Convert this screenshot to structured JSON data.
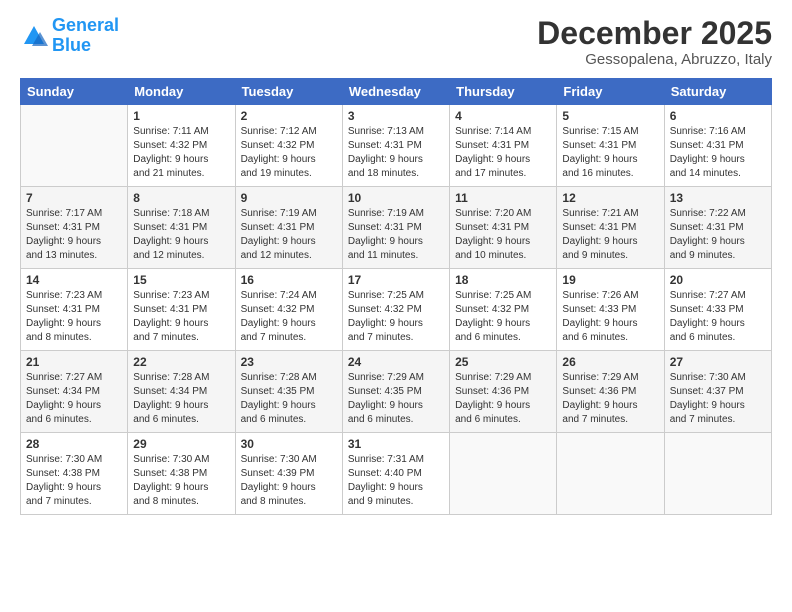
{
  "header": {
    "logo_general": "General",
    "logo_blue": "Blue",
    "month": "December 2025",
    "location": "Gessopalena, Abruzzo, Italy"
  },
  "days_header": [
    "Sunday",
    "Monday",
    "Tuesday",
    "Wednesday",
    "Thursday",
    "Friday",
    "Saturday"
  ],
  "weeks": [
    [
      {
        "day": "",
        "text": ""
      },
      {
        "day": "1",
        "text": "Sunrise: 7:11 AM\nSunset: 4:32 PM\nDaylight: 9 hours\nand 21 minutes."
      },
      {
        "day": "2",
        "text": "Sunrise: 7:12 AM\nSunset: 4:32 PM\nDaylight: 9 hours\nand 19 minutes."
      },
      {
        "day": "3",
        "text": "Sunrise: 7:13 AM\nSunset: 4:31 PM\nDaylight: 9 hours\nand 18 minutes."
      },
      {
        "day": "4",
        "text": "Sunrise: 7:14 AM\nSunset: 4:31 PM\nDaylight: 9 hours\nand 17 minutes."
      },
      {
        "day": "5",
        "text": "Sunrise: 7:15 AM\nSunset: 4:31 PM\nDaylight: 9 hours\nand 16 minutes."
      },
      {
        "day": "6",
        "text": "Sunrise: 7:16 AM\nSunset: 4:31 PM\nDaylight: 9 hours\nand 14 minutes."
      }
    ],
    [
      {
        "day": "7",
        "text": "Sunrise: 7:17 AM\nSunset: 4:31 PM\nDaylight: 9 hours\nand 13 minutes."
      },
      {
        "day": "8",
        "text": "Sunrise: 7:18 AM\nSunset: 4:31 PM\nDaylight: 9 hours\nand 12 minutes."
      },
      {
        "day": "9",
        "text": "Sunrise: 7:19 AM\nSunset: 4:31 PM\nDaylight: 9 hours\nand 12 minutes."
      },
      {
        "day": "10",
        "text": "Sunrise: 7:19 AM\nSunset: 4:31 PM\nDaylight: 9 hours\nand 11 minutes."
      },
      {
        "day": "11",
        "text": "Sunrise: 7:20 AM\nSunset: 4:31 PM\nDaylight: 9 hours\nand 10 minutes."
      },
      {
        "day": "12",
        "text": "Sunrise: 7:21 AM\nSunset: 4:31 PM\nDaylight: 9 hours\nand 9 minutes."
      },
      {
        "day": "13",
        "text": "Sunrise: 7:22 AM\nSunset: 4:31 PM\nDaylight: 9 hours\nand 9 minutes."
      }
    ],
    [
      {
        "day": "14",
        "text": "Sunrise: 7:23 AM\nSunset: 4:31 PM\nDaylight: 9 hours\nand 8 minutes."
      },
      {
        "day": "15",
        "text": "Sunrise: 7:23 AM\nSunset: 4:31 PM\nDaylight: 9 hours\nand 7 minutes."
      },
      {
        "day": "16",
        "text": "Sunrise: 7:24 AM\nSunset: 4:32 PM\nDaylight: 9 hours\nand 7 minutes."
      },
      {
        "day": "17",
        "text": "Sunrise: 7:25 AM\nSunset: 4:32 PM\nDaylight: 9 hours\nand 7 minutes."
      },
      {
        "day": "18",
        "text": "Sunrise: 7:25 AM\nSunset: 4:32 PM\nDaylight: 9 hours\nand 6 minutes."
      },
      {
        "day": "19",
        "text": "Sunrise: 7:26 AM\nSunset: 4:33 PM\nDaylight: 9 hours\nand 6 minutes."
      },
      {
        "day": "20",
        "text": "Sunrise: 7:27 AM\nSunset: 4:33 PM\nDaylight: 9 hours\nand 6 minutes."
      }
    ],
    [
      {
        "day": "21",
        "text": "Sunrise: 7:27 AM\nSunset: 4:34 PM\nDaylight: 9 hours\nand 6 minutes."
      },
      {
        "day": "22",
        "text": "Sunrise: 7:28 AM\nSunset: 4:34 PM\nDaylight: 9 hours\nand 6 minutes."
      },
      {
        "day": "23",
        "text": "Sunrise: 7:28 AM\nSunset: 4:35 PM\nDaylight: 9 hours\nand 6 minutes."
      },
      {
        "day": "24",
        "text": "Sunrise: 7:29 AM\nSunset: 4:35 PM\nDaylight: 9 hours\nand 6 minutes."
      },
      {
        "day": "25",
        "text": "Sunrise: 7:29 AM\nSunset: 4:36 PM\nDaylight: 9 hours\nand 6 minutes."
      },
      {
        "day": "26",
        "text": "Sunrise: 7:29 AM\nSunset: 4:36 PM\nDaylight: 9 hours\nand 7 minutes."
      },
      {
        "day": "27",
        "text": "Sunrise: 7:30 AM\nSunset: 4:37 PM\nDaylight: 9 hours\nand 7 minutes."
      }
    ],
    [
      {
        "day": "28",
        "text": "Sunrise: 7:30 AM\nSunset: 4:38 PM\nDaylight: 9 hours\nand 7 minutes."
      },
      {
        "day": "29",
        "text": "Sunrise: 7:30 AM\nSunset: 4:38 PM\nDaylight: 9 hours\nand 8 minutes."
      },
      {
        "day": "30",
        "text": "Sunrise: 7:30 AM\nSunset: 4:39 PM\nDaylight: 9 hours\nand 8 minutes."
      },
      {
        "day": "31",
        "text": "Sunrise: 7:31 AM\nSunset: 4:40 PM\nDaylight: 9 hours\nand 9 minutes."
      },
      {
        "day": "",
        "text": ""
      },
      {
        "day": "",
        "text": ""
      },
      {
        "day": "",
        "text": ""
      }
    ]
  ]
}
